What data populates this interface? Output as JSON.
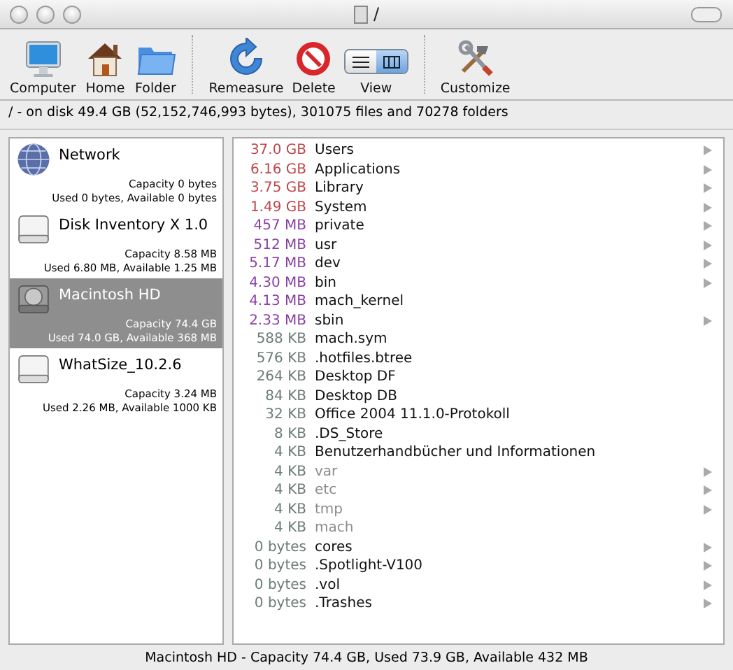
{
  "window": {
    "title": "/"
  },
  "toolbar": [
    {
      "label": "Computer"
    },
    {
      "label": "Home"
    },
    {
      "label": "Folder"
    },
    {
      "label": "Remeasure"
    },
    {
      "label": "Delete"
    },
    {
      "label": "View",
      "kind": "segmented",
      "segments": [
        {
          "selected": false
        },
        {
          "selected": true
        }
      ]
    },
    {
      "label": "Customize"
    }
  ],
  "path_info": "/ - on disk 49.4 GB (52,152,746,993 bytes), 301075 files and 70278 folders",
  "volumes": [
    {
      "name": "Network",
      "capacity": "Capacity 0 bytes",
      "usage": "Used 0 bytes, Available 0 bytes",
      "kind": "network",
      "selected": false
    },
    {
      "name": "Disk Inventory X 1.0",
      "capacity": "Capacity 8.58 MB",
      "usage": "Used 6.80 MB, Available 1.25 MB",
      "kind": "disk",
      "selected": false
    },
    {
      "name": "Macintosh HD",
      "capacity": "Capacity 74.4 GB",
      "usage": "Used 74.0 GB, Available 368 MB",
      "kind": "harddisk",
      "selected": true
    },
    {
      "name": "WhatSize_10.2.6",
      "capacity": "Capacity 3.24 MB",
      "usage": "Used 2.26 MB, Available 1000 KB",
      "kind": "disk",
      "selected": false
    }
  ],
  "files": [
    {
      "size": "37.0 GB",
      "name": "Users",
      "color": "#c0464c",
      "expandable": true,
      "dimmed": false
    },
    {
      "size": "6.16 GB",
      "name": "Applications",
      "color": "#c0464c",
      "expandable": true,
      "dimmed": false
    },
    {
      "size": "3.75 GB",
      "name": "Library",
      "color": "#c0464c",
      "expandable": true,
      "dimmed": false
    },
    {
      "size": "1.49 GB",
      "name": "System",
      "color": "#c0464c",
      "expandable": true,
      "dimmed": false
    },
    {
      "size": "457 MB",
      "name": "private",
      "color": "#8a3fa6",
      "expandable": true,
      "dimmed": false
    },
    {
      "size": "512 MB",
      "name": "usr",
      "color": "#8a3fa6",
      "expandable": true,
      "dimmed": false
    },
    {
      "size": "5.17 MB",
      "name": "dev",
      "color": "#8a3fa6",
      "expandable": true,
      "dimmed": false
    },
    {
      "size": "4.30 MB",
      "name": "bin",
      "color": "#8a3fa6",
      "expandable": true,
      "dimmed": false
    },
    {
      "size": "4.13 MB",
      "name": "mach_kernel",
      "color": "#8a3fa6",
      "expandable": false,
      "dimmed": false
    },
    {
      "size": "2.33 MB",
      "name": "sbin",
      "color": "#8a3fa6",
      "expandable": true,
      "dimmed": false
    },
    {
      "size": "588 KB",
      "name": "mach.sym",
      "color": "#6b7b79",
      "expandable": false,
      "dimmed": false
    },
    {
      "size": "576 KB",
      "name": ".hotfiles.btree",
      "color": "#6b7b79",
      "expandable": false,
      "dimmed": false
    },
    {
      "size": "264 KB",
      "name": "Desktop DF",
      "color": "#6b7b79",
      "expandable": false,
      "dimmed": false
    },
    {
      "size": "84 KB",
      "name": "Desktop DB",
      "color": "#6b7b79",
      "expandable": false,
      "dimmed": false
    },
    {
      "size": "32 KB",
      "name": "Office 2004 11.1.0-Protokoll",
      "color": "#6b7b79",
      "expandable": false,
      "dimmed": false
    },
    {
      "size": "8 KB",
      "name": ".DS_Store",
      "color": "#6b7b79",
      "expandable": false,
      "dimmed": false
    },
    {
      "size": "4 KB",
      "name": "Benutzerhandbücher und Informationen",
      "color": "#6b7b79",
      "expandable": false,
      "dimmed": false
    },
    {
      "size": "4 KB",
      "name": "var",
      "color": "#6b7b79",
      "expandable": true,
      "dimmed": true
    },
    {
      "size": "4 KB",
      "name": "etc",
      "color": "#6b7b79",
      "expandable": true,
      "dimmed": true
    },
    {
      "size": "4 KB",
      "name": "tmp",
      "color": "#6b7b79",
      "expandable": true,
      "dimmed": true
    },
    {
      "size": "4 KB",
      "name": "mach",
      "color": "#6b7b79",
      "expandable": false,
      "dimmed": true
    },
    {
      "size": "0 bytes",
      "name": "cores",
      "color": "#6b7b79",
      "expandable": true,
      "dimmed": false
    },
    {
      "size": "0 bytes",
      "name": ".Spotlight-V100",
      "color": "#6b7b79",
      "expandable": true,
      "dimmed": false
    },
    {
      "size": "0 bytes",
      "name": ".vol",
      "color": "#6b7b79",
      "expandable": true,
      "dimmed": false
    },
    {
      "size": "0 bytes",
      "name": ".Trashes",
      "color": "#6b7b79",
      "expandable": true,
      "dimmed": false
    }
  ],
  "status_bar": "Macintosh HD - Capacity 74.4 GB, Used 73.9 GB, Available 432 MB"
}
